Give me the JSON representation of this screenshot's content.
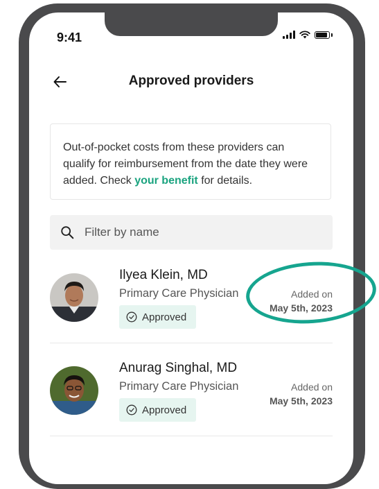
{
  "status_bar": {
    "time": "9:41"
  },
  "header": {
    "title": "Approved providers"
  },
  "info": {
    "text_before": "Out-of-pocket costs from these providers can qualify for reimbursement from the date they were added. Check ",
    "link": "your benefit",
    "text_after": " for details."
  },
  "search": {
    "placeholder": "Filter by name",
    "value": ""
  },
  "providers": [
    {
      "name": "Ilyea Klein, MD",
      "role": "Primary Care Physician",
      "status": "Approved",
      "added_label": "Added on",
      "added_date": "May 5th, 2023"
    },
    {
      "name": "Anurag Singhal, MD",
      "role": "Primary Care Physician",
      "status": "Approved",
      "added_label": "Added on",
      "added_date": "May 5th, 2023"
    }
  ],
  "colors": {
    "accent": "#1aa37f",
    "badge_bg": "#e6f5f0",
    "highlight": "#16a58f",
    "frame": "#4a4a4c"
  }
}
